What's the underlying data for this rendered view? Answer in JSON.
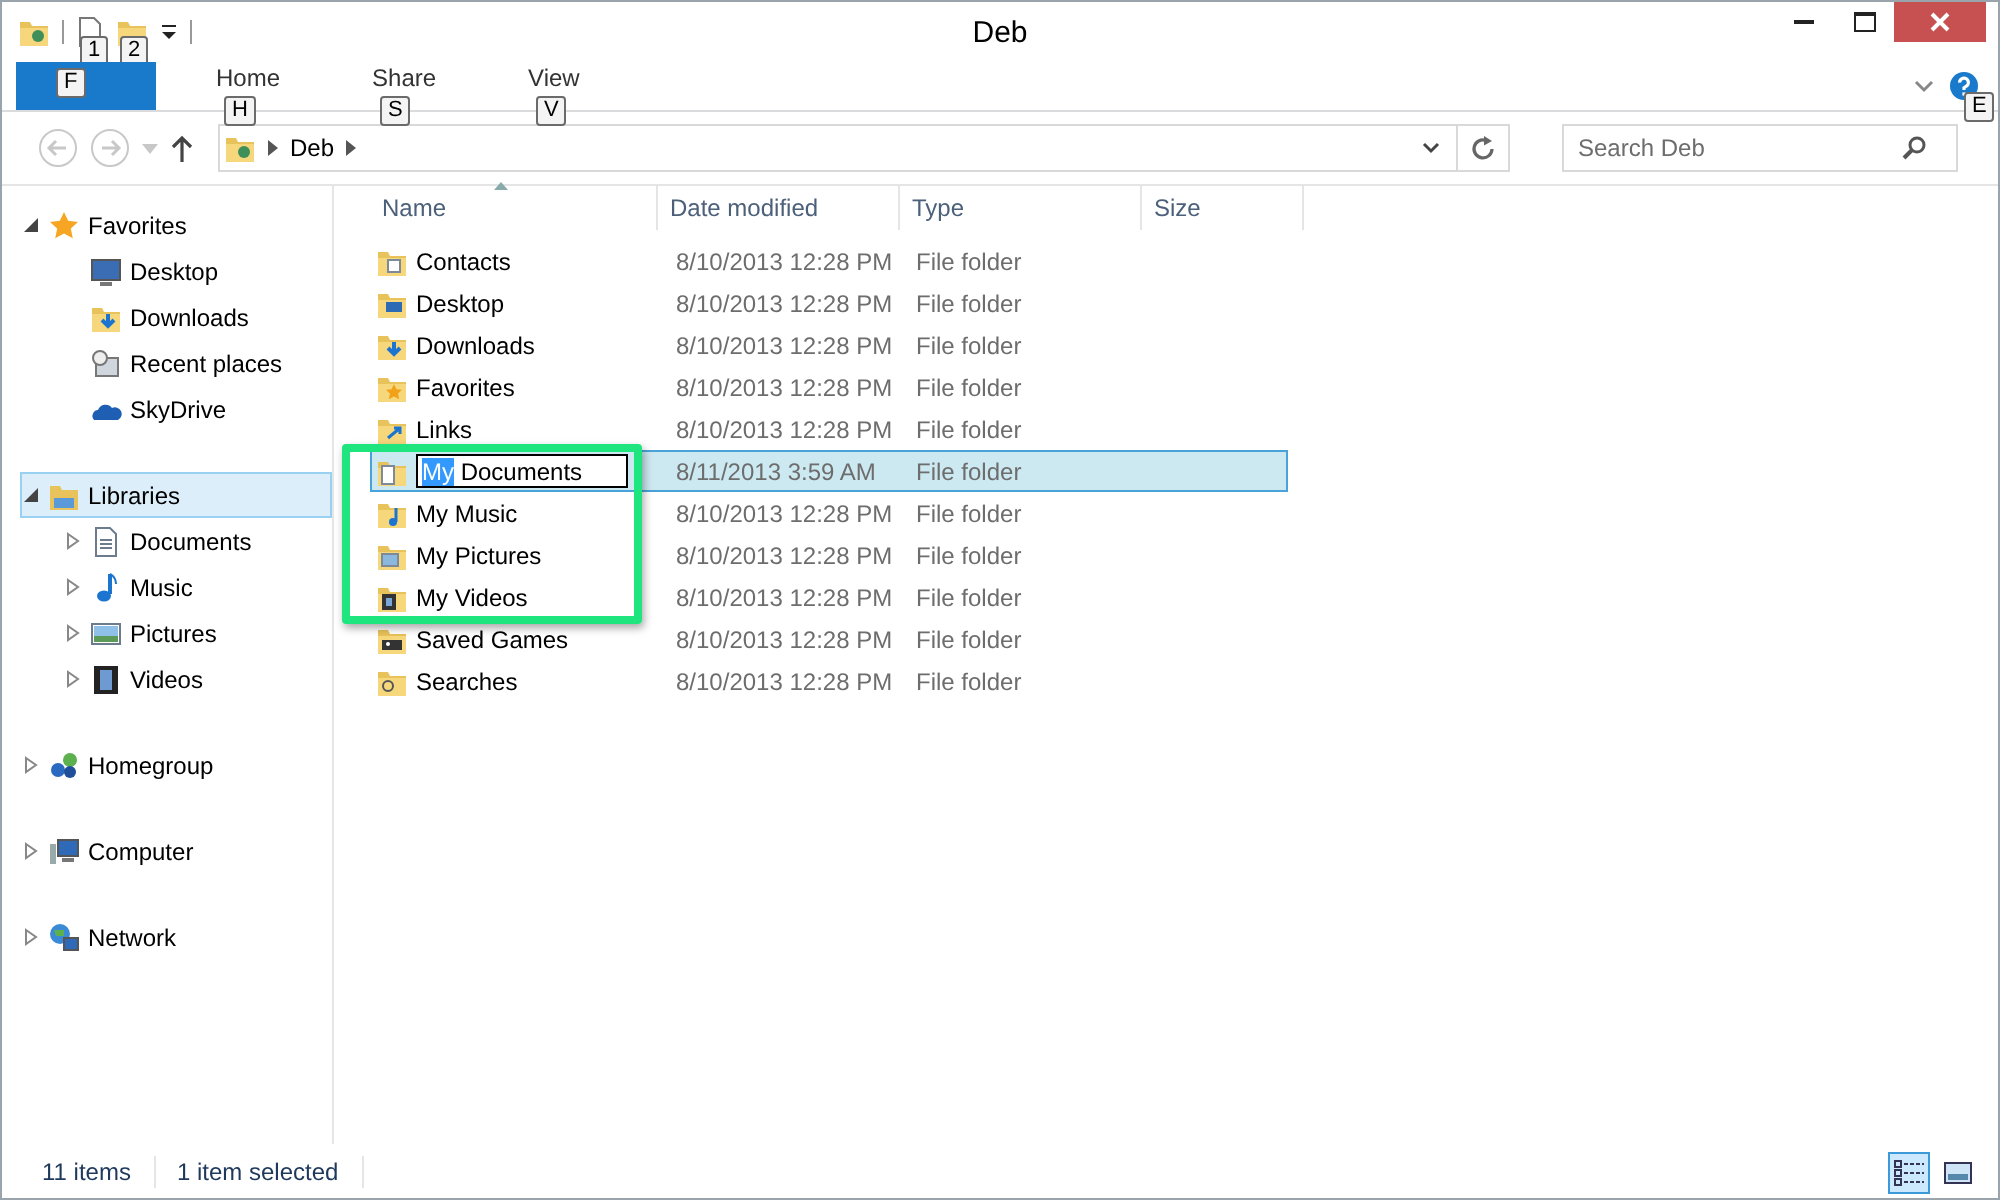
{
  "window": {
    "title": "Deb"
  },
  "quick_access": [
    {
      "kind": "properties",
      "keytip": "1"
    },
    {
      "kind": "newfolder",
      "keytip": "2"
    }
  ],
  "ribbon": {
    "file_tab": {
      "keytip": "F"
    },
    "tabs": [
      {
        "label": "Home",
        "keytip": "H"
      },
      {
        "label": "Share",
        "keytip": "S"
      },
      {
        "label": "View",
        "keytip": "V"
      }
    ],
    "help_keytip": "E"
  },
  "address_bar": {
    "path": [
      "Deb"
    ]
  },
  "search": {
    "placeholder": "Search Deb"
  },
  "navigation": [
    {
      "label": "Favorites",
      "kind": "star",
      "expanded": true,
      "selected": false,
      "children": [
        {
          "label": "Desktop",
          "kind": "desktop"
        },
        {
          "label": "Downloads",
          "kind": "downloads"
        },
        {
          "label": "Recent places",
          "kind": "recent"
        },
        {
          "label": "SkyDrive",
          "kind": "cloud"
        }
      ]
    },
    {
      "label": "Libraries",
      "kind": "library",
      "expanded": true,
      "selected": true,
      "children": [
        {
          "label": "Documents",
          "kind": "documents",
          "expanded": false
        },
        {
          "label": "Music",
          "kind": "music",
          "expanded": false
        },
        {
          "label": "Pictures",
          "kind": "pictures",
          "expanded": false
        },
        {
          "label": "Videos",
          "kind": "videos",
          "expanded": false
        }
      ]
    },
    {
      "label": "Homegroup",
      "kind": "homegroup",
      "expanded": false,
      "selected": false
    },
    {
      "label": "Computer",
      "kind": "computer",
      "expanded": false,
      "selected": false
    },
    {
      "label": "Network",
      "kind": "network",
      "expanded": false,
      "selected": false
    }
  ],
  "table": {
    "columns": [
      "Name",
      "Date modified",
      "Type",
      "Size"
    ],
    "rows": [
      {
        "name": "Contacts",
        "date": "8/10/2013 12:28 PM",
        "type": "File folder",
        "kind": "contacts",
        "selected": false
      },
      {
        "name": "Desktop",
        "date": "8/10/2013 12:28 PM",
        "type": "File folder",
        "kind": "desktop",
        "selected": false
      },
      {
        "name": "Downloads",
        "date": "8/10/2013 12:28 PM",
        "type": "File folder",
        "kind": "downloads",
        "selected": false
      },
      {
        "name": "Favorites",
        "date": "8/10/2013 12:28 PM",
        "type": "File folder",
        "kind": "favorites",
        "selected": false
      },
      {
        "name": "Links",
        "date": "8/10/2013 12:28 PM",
        "type": "File folder",
        "kind": "links",
        "selected": false
      },
      {
        "rename": {
          "selected_text": "My",
          "unselected_text": " Documents"
        },
        "date": "8/11/2013 3:59 AM",
        "type": "File folder",
        "kind": "documents",
        "selected": true
      },
      {
        "name": "My Music",
        "date": "8/10/2013 12:28 PM",
        "type": "File folder",
        "kind": "music",
        "selected": false
      },
      {
        "name": "My Pictures",
        "date": "8/10/2013 12:28 PM",
        "type": "File folder",
        "kind": "pictures",
        "selected": false
      },
      {
        "name": "My Videos",
        "date": "8/10/2013 12:28 PM",
        "type": "File folder",
        "kind": "videos",
        "selected": false
      },
      {
        "name": "Saved Games",
        "date": "8/10/2013 12:28 PM",
        "type": "File folder",
        "kind": "games",
        "selected": false
      },
      {
        "name": "Searches",
        "date": "8/10/2013 12:28 PM",
        "type": "File folder",
        "kind": "searches",
        "selected": false
      }
    ]
  },
  "status_bar": {
    "item_count": "11 items",
    "selection": "1 item selected",
    "views": [
      {
        "kind": "details",
        "selected": true
      },
      {
        "kind": "tiles",
        "selected": false
      }
    ]
  }
}
